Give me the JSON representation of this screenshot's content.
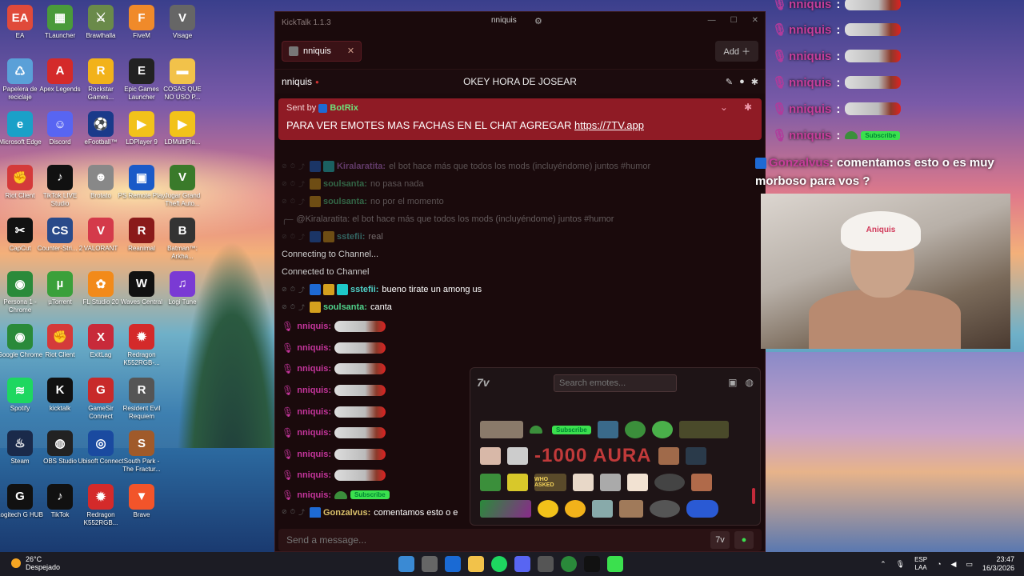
{
  "desktop": {
    "icons": [
      {
        "label": "EA",
        "color": "#e04a3a",
        "glyph": "EA"
      },
      {
        "label": "TLauncher",
        "color": "#4a9a3a",
        "glyph": "▦"
      },
      {
        "label": "Brawlhalla",
        "color": "#6a8a4a",
        "glyph": "⚔"
      },
      {
        "label": "FiveM",
        "color": "#f08a2a",
        "glyph": "F"
      },
      {
        "label": "Visage",
        "color": "#666",
        "glyph": "V"
      },
      {
        "label": "Papelera de reciclaje",
        "color": "#5aa0d8",
        "glyph": "♺"
      },
      {
        "label": "Apex Legends",
        "color": "#d42a2a",
        "glyph": "A"
      },
      {
        "label": "Rockstar Games...",
        "color": "#f2b21a",
        "glyph": "R"
      },
      {
        "label": "Epic Games Launcher",
        "color": "#222",
        "glyph": "E"
      },
      {
        "label": "COSAS QUE NO USO P...",
        "color": "#f2c24a",
        "glyph": "▬"
      },
      {
        "label": "Microsoft Edge",
        "color": "#1aa0c8",
        "glyph": "e"
      },
      {
        "label": "Discord",
        "color": "#5865f2",
        "glyph": "☺"
      },
      {
        "label": "eFootball™",
        "color": "#1a3a8a",
        "glyph": "⚽"
      },
      {
        "label": "LDPlayer 9",
        "color": "#f2c21a",
        "glyph": "▶"
      },
      {
        "label": "LDMultiPla...",
        "color": "#f2c21a",
        "glyph": "▶"
      },
      {
        "label": "Riot Client",
        "color": "#d43a3a",
        "glyph": "✊"
      },
      {
        "label": "TikTok LIVE Studio",
        "color": "#111",
        "glyph": "♪"
      },
      {
        "label": "Brotato",
        "color": "#888",
        "glyph": "☻"
      },
      {
        "label": "PS Remote Play",
        "color": "#1a5ac8",
        "glyph": "▣"
      },
      {
        "label": "Jugar Grand Theft Auto...",
        "color": "#3a7a2a",
        "glyph": "V"
      },
      {
        "label": "CapCut",
        "color": "#111",
        "glyph": "✂"
      },
      {
        "label": "Counter-Stri... 2",
        "color": "#2a4a8a",
        "glyph": "CS"
      },
      {
        "label": "VALORANT",
        "color": "#d43a4a",
        "glyph": "V"
      },
      {
        "label": "Reanimal",
        "color": "#8a1a1a",
        "glyph": "R"
      },
      {
        "label": "Batman™: Arkha...",
        "color": "#333",
        "glyph": "B"
      },
      {
        "label": "Persona 1 - Chrome",
        "color": "#2a8a3a",
        "glyph": "◉"
      },
      {
        "label": "µTorrent",
        "color": "#3aa03a",
        "glyph": "µ"
      },
      {
        "label": "FL Studio 20",
        "color": "#f28a1a",
        "glyph": "✿"
      },
      {
        "label": "Waves Central",
        "color": "#111",
        "glyph": "W"
      },
      {
        "label": "Logi Tune",
        "color": "#7a3ad4",
        "glyph": "♫"
      },
      {
        "label": "Google Chrome",
        "color": "#2a8a3a",
        "glyph": "◉"
      },
      {
        "label": "Riot Client",
        "color": "#d43a3a",
        "glyph": "✊"
      },
      {
        "label": "ExitLag",
        "color": "#c82a3a",
        "glyph": "X"
      },
      {
        "label": "Redragon K552RGB-...",
        "color": "#d42a2a",
        "glyph": "✹"
      },
      {
        "label": "",
        "color": "",
        "glyph": ""
      },
      {
        "label": "Spotify",
        "color": "#1ed760",
        "glyph": "≋"
      },
      {
        "label": "kicktalk",
        "color": "#111",
        "glyph": "K"
      },
      {
        "label": "GameSir Connect",
        "color": "#c82a2a",
        "glyph": "G"
      },
      {
        "label": "Resident Evil Requiem",
        "color": "#555",
        "glyph": "R"
      },
      {
        "label": "",
        "color": "",
        "glyph": ""
      },
      {
        "label": "Steam",
        "color": "#1a2a4a",
        "glyph": "♨"
      },
      {
        "label": "OBS Studio",
        "color": "#222",
        "glyph": "◍"
      },
      {
        "label": "Ubisoft Connect",
        "color": "#1a4aa0",
        "glyph": "◎"
      },
      {
        "label": "South Park - The Fractur...",
        "color": "#a05a2a",
        "glyph": "S"
      },
      {
        "label": "",
        "color": "",
        "glyph": ""
      },
      {
        "label": "Logitech G HUB",
        "color": "#111",
        "glyph": "G"
      },
      {
        "label": "TikTok",
        "color": "#111",
        "glyph": "♪"
      },
      {
        "label": "Redragon K552RGB...",
        "color": "#d42a2a",
        "glyph": "✹"
      },
      {
        "label": "Brave",
        "color": "#f2542a",
        "glyph": "▼"
      }
    ]
  },
  "kicktalk": {
    "app_title": "KickTalk 1.1.3",
    "titlebar_user": "nniquis",
    "tab_label": "nniquis",
    "add_label": "Add",
    "channel_name": "nniquis",
    "stream_title": "OKEY HORA DE JOSEAR",
    "pinned": {
      "sent_by": "Sent by",
      "author": "BotRix",
      "message": "PARA VER EMOTES MAS FACHAS EN EL CHAT AGREGAR",
      "link": "https://7TV.app"
    },
    "messages": [
      {
        "user": "Kiralaratita:",
        "color": "#b874d9",
        "text": "el bot hace más que todos los mods (incluyéndome) juntos #humor",
        "badges": [
          "b-blue",
          "b-cyan"
        ],
        "faded": true
      },
      {
        "user": "soulsanta:",
        "color": "#4fd18a",
        "text": "no pasa nada",
        "badges": [
          "b-gold"
        ],
        "faded": true
      },
      {
        "user": "soulsanta:",
        "color": "#4fd18a",
        "text": "no por el momento",
        "badges": [
          "b-gold"
        ],
        "faded": true
      }
    ],
    "reply_line": "@Kiralaratita: el bot hace más que todos los mods (incluyéndome) juntos #humor",
    "sstefii_short": {
      "user": "sstefii:",
      "text": "real"
    },
    "sys_connecting": "Connecting to Channel...",
    "sys_connected": "Connected to Channel",
    "msg_sstefii": {
      "user": "sstefii:",
      "text": "bueno tirate un among us",
      "color": "#4fd1c8"
    },
    "msg_soulsanta": {
      "user": "soulsanta:",
      "text": "canta",
      "color": "#4fd18a"
    },
    "nniquis_user": "nniquis:",
    "subscribe_label": "Subscribe",
    "msg_gonzalvus": {
      "user": "Gonzalvus:",
      "text": "comentamos esto o e",
      "color": "#d9c06a"
    },
    "composer_placeholder": "Send a message...",
    "picker": {
      "search_placeholder": "Search emotes...",
      "aura_text": "-1000 AURA",
      "who_asked": "WHO ASKED"
    }
  },
  "overlay": {
    "user": "nniquis",
    "colon": ":",
    "subscribe": "Subscribe",
    "message_user": "Gonzalvus",
    "message_text": ": comentamos esto o es muy morboso para vos ?",
    "cam_cap_text": "Aniquis"
  },
  "taskbar": {
    "temp": "26°C",
    "weather": "Despejado",
    "lang_top": "ESP",
    "lang_bottom": "LAA",
    "time": "23:47",
    "date": "16/3/2026"
  },
  "colors": {
    "accent": "#8f1b25",
    "mention": "#c4359b",
    "bg": "#1a0a0c"
  }
}
